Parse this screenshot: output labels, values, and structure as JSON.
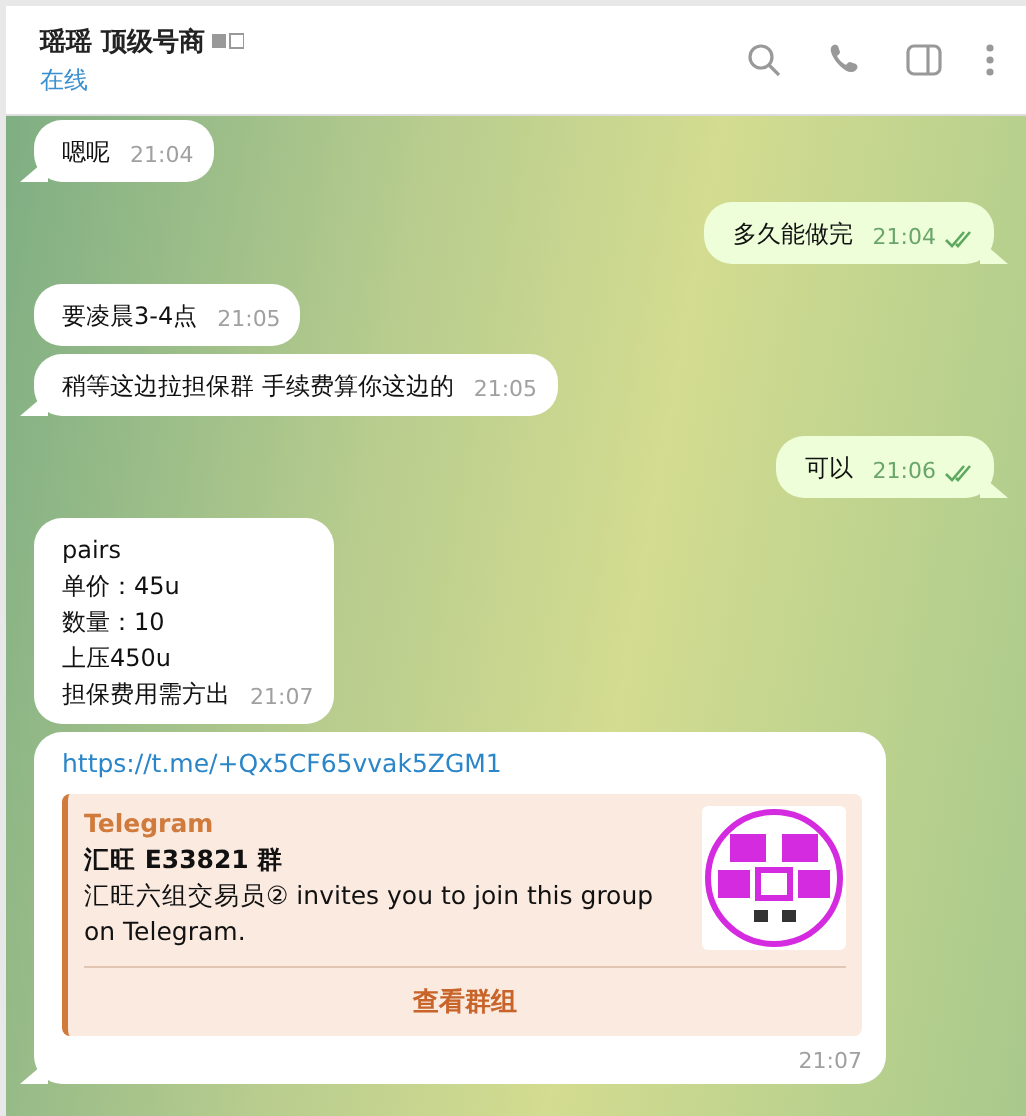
{
  "header": {
    "title": "瑶瑶 顶级号商",
    "status": "在线"
  },
  "messages": [
    {
      "kind": "text",
      "outgoing": false,
      "lines": [
        "嗯呢"
      ],
      "time": "21:04"
    },
    {
      "kind": "text",
      "outgoing": true,
      "lines": [
        "多久能做完"
      ],
      "time": "21:04",
      "read": true
    },
    {
      "kind": "text",
      "outgoing": false,
      "lines": [
        "要凌晨3-4点"
      ],
      "time": "21:05"
    },
    {
      "kind": "text",
      "outgoing": false,
      "lines": [
        "稍等这边拉担保群 手续费算你这边的"
      ],
      "time": "21:05"
    },
    {
      "kind": "text",
      "outgoing": true,
      "lines": [
        "可以"
      ],
      "time": "21:06",
      "read": true
    },
    {
      "kind": "text",
      "outgoing": false,
      "lines": [
        "pairs",
        "单价：45u",
        "数量：10",
        "上压450u",
        "担保费用需方出"
      ],
      "time": "21:07"
    },
    {
      "kind": "link",
      "outgoing": false,
      "url": "https://t.me/+Qx5CF65vvak5ZGM1",
      "preview": {
        "site": "Telegram",
        "title": "汇旺 E33821 群",
        "description": "汇旺六组交易员② invites you to join this group on Telegram.",
        "button": "查看群组"
      },
      "time": "21:07"
    }
  ]
}
